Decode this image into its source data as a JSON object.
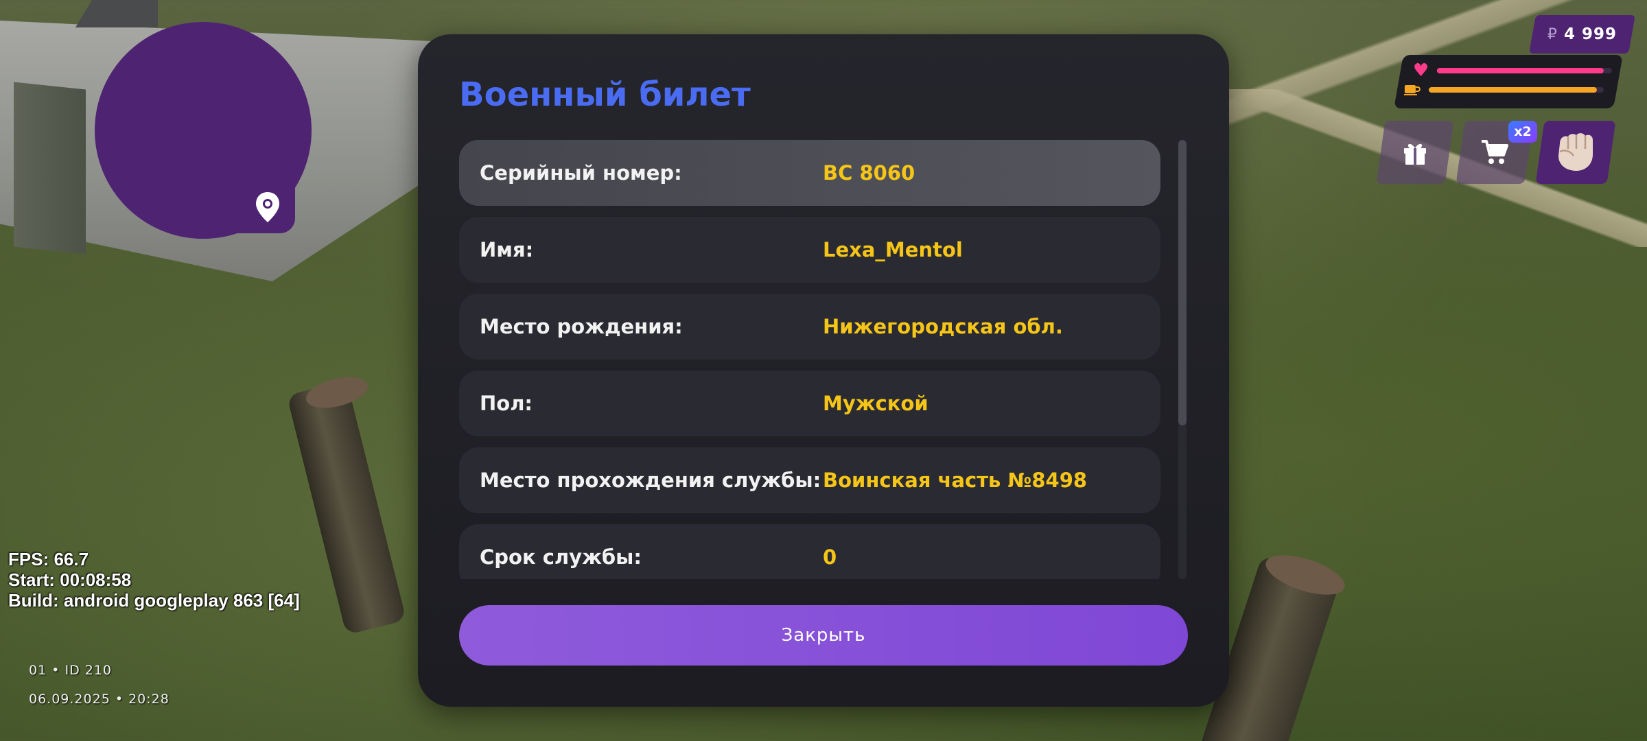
{
  "dialog": {
    "title": "Военный билет",
    "rows": [
      {
        "label": "Серийный номер:",
        "value": "ВС 8060"
      },
      {
        "label": "Имя:",
        "value": "Lexa_Mentol"
      },
      {
        "label": "Место рождения:",
        "value": "Нижегородская обл."
      },
      {
        "label": "Пол:",
        "value": "Мужской"
      },
      {
        "label": "Место прохождения службы:",
        "value": "Воинская часть №8498"
      },
      {
        "label": "Срок службы:",
        "value": "0"
      }
    ],
    "close_label": "Закрыть"
  },
  "debug": {
    "fps": "FPS: 66.7",
    "start": "Start: 00:08:58",
    "build": "Build: android googleplay 863 [64]"
  },
  "server_info": {
    "line1": "01 • ID 210",
    "line2": "06.09.2025 • 20:28"
  },
  "hud": {
    "currency_symbol": "₽",
    "money": "4 999",
    "x2_badge": "x2",
    "health_level": 0.95,
    "hunger_level": 0.96,
    "icons": [
      "map-pin-icon",
      "heart-icon",
      "cup-icon",
      "gift-icon",
      "cart-icon",
      "fist-icon"
    ]
  },
  "colors": {
    "title": "#4a6cf2",
    "value": "#f5c518",
    "accent": "#8a50d8",
    "minimap": "#4e2472",
    "health": "#ff3b8a",
    "hunger": "#f5a623"
  }
}
